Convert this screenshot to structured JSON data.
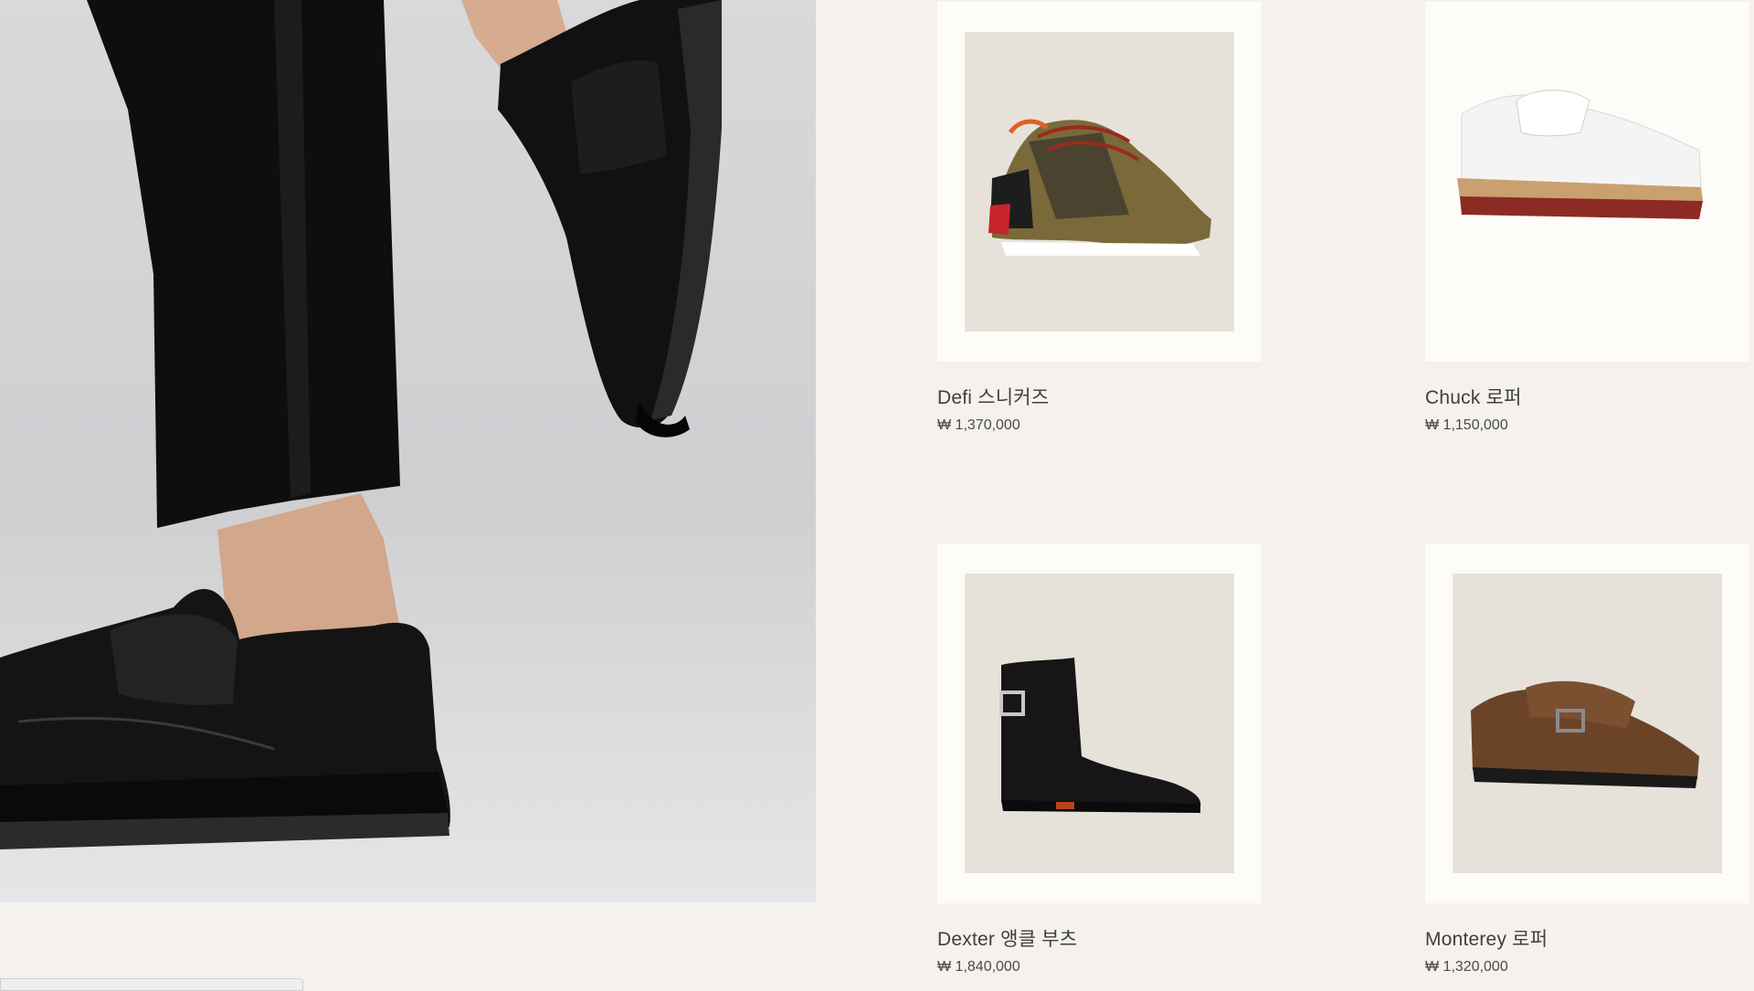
{
  "products": [
    {
      "name": "Defi 스니커즈",
      "price": "₩ 1,370,000",
      "image": "sneaker-image"
    },
    {
      "name": "Chuck 로퍼",
      "price": "₩ 1,150,000",
      "image": "white-loafer-image"
    },
    {
      "name": "Dexter 앵클 부츠",
      "price": "₩ 1,840,000",
      "image": "ankle-boot-image"
    },
    {
      "name": "Monterey 로퍼",
      "price": "₩ 1,320,000",
      "image": "brown-loafer-image"
    }
  ],
  "hero": {
    "image": "black-loafers-lifestyle-image"
  },
  "colors": {
    "page_bg": "#f5f2ee",
    "card_bg": "#fefcf8",
    "photo_bg": "#e6e2da"
  }
}
